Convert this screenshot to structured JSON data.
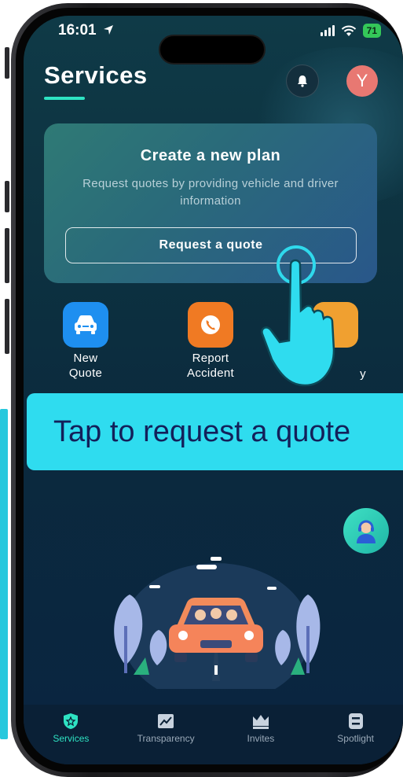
{
  "status_bar": {
    "time": "16:01",
    "battery": "71"
  },
  "header": {
    "title": "Services",
    "avatar_initial": "Y"
  },
  "plan_card": {
    "title": "Create a new plan",
    "subtitle": "Request quotes by providing vehicle and driver information",
    "button_label": "Request a quote"
  },
  "actions": [
    {
      "label": "New Quote",
      "icon": "car-icon",
      "color": "#1e8ff0"
    },
    {
      "label": "Report Accident",
      "icon": "phone-call-icon",
      "color": "#f07a23"
    },
    {
      "label": "y",
      "icon": "unknown-icon",
      "color": "#f0a030"
    }
  ],
  "callout": {
    "text": "Tap to request a quote",
    "color": "#2fdcef"
  },
  "tabs": [
    {
      "label": "Services",
      "icon": "star-shield-icon",
      "active": true
    },
    {
      "label": "Transparency",
      "icon": "chart-icon",
      "active": false
    },
    {
      "label": "Invites",
      "icon": "crown-icon",
      "active": false
    },
    {
      "label": "Spotlight",
      "icon": "list-icon",
      "active": false
    }
  ],
  "colors": {
    "accent": "#2ee3c3",
    "background": "#0b2a3e",
    "card": "#2a6b7a"
  }
}
